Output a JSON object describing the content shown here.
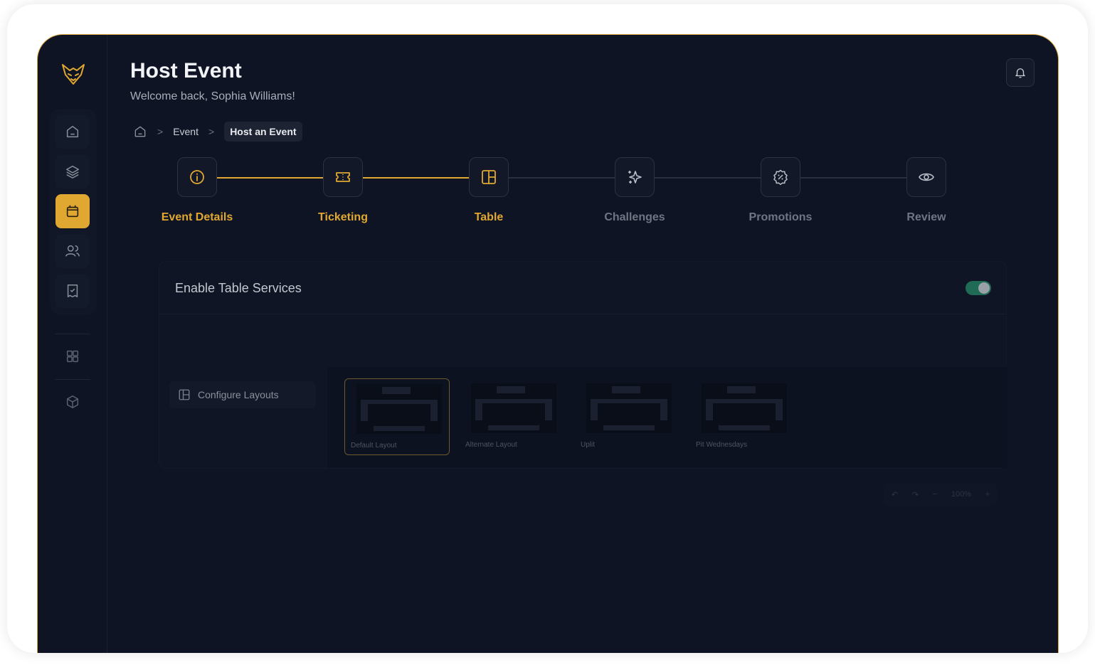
{
  "page": {
    "title": "Host Event",
    "subtitle": "Welcome back, Sophia Williams!"
  },
  "breadcrumb": {
    "home_icon": "home-icon",
    "items": [
      "Event",
      "Host an Event"
    ],
    "separator": ">"
  },
  "sidebar": {
    "items": [
      {
        "icon": "home-icon",
        "active": false
      },
      {
        "icon": "layers-icon",
        "active": false
      },
      {
        "icon": "calendar-icon",
        "active": true
      },
      {
        "icon": "users-icon",
        "active": false
      },
      {
        "icon": "receipt-check-icon",
        "active": false
      }
    ],
    "extra": [
      {
        "icon": "grid-icon"
      },
      {
        "icon": "cube-icon"
      }
    ]
  },
  "stepper": {
    "steps": [
      {
        "label": "Event Details",
        "icon": "info-icon",
        "done": true
      },
      {
        "label": "Ticketing",
        "icon": "ticket-icon",
        "done": true
      },
      {
        "label": "Table",
        "icon": "table-layout-icon",
        "done": true
      },
      {
        "label": "Challenges",
        "icon": "sparkles-icon",
        "done": false
      },
      {
        "label": "Promotions",
        "icon": "discount-icon",
        "done": false
      },
      {
        "label": "Review",
        "icon": "eye-icon",
        "done": false
      }
    ]
  },
  "table_services": {
    "title": "Enable Table Services",
    "enabled": true,
    "configure_label": "Configure Layouts",
    "layouts": [
      {
        "name": "Default Layout",
        "selected": true
      },
      {
        "name": "Alternate Layout",
        "selected": false
      },
      {
        "name": "Uplit",
        "selected": false
      },
      {
        "name": "Pit Wednesdays",
        "selected": false
      }
    ]
  },
  "zoom": {
    "level": "100%",
    "minus": "−",
    "plus": "+"
  },
  "colors": {
    "accent": "#e0a831",
    "background": "#0f1424",
    "toggle_on": "#1f6b55"
  }
}
